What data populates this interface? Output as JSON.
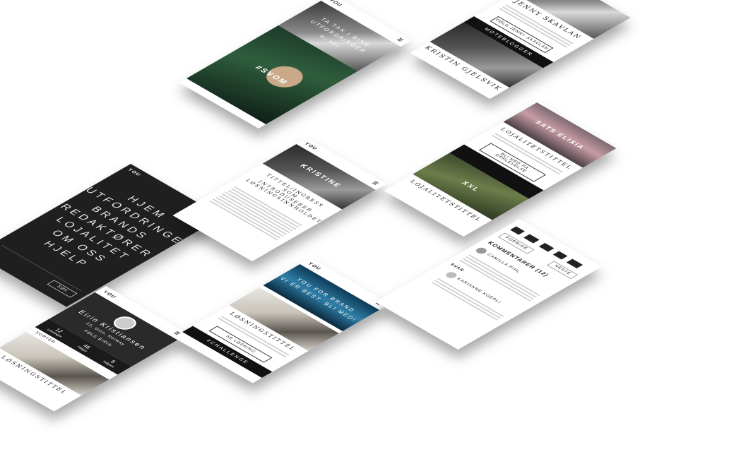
{
  "brand": "YOU",
  "screens": {
    "top_left": {
      "hero_lines": [
        "TA TAK I DINE",
        "UTFORDRINGER"
      ],
      "hero_sub": "BLI MED",
      "card_tag": "#SVOM",
      "card_caption": "#SVOM"
    },
    "top_right": {
      "name_1": "JENNY SKAVLAN",
      "button_1": "FØLG JENNY SKAVLAN",
      "bar_label": "MOTEBLOGGER",
      "name_2": "KRISTIN GJELSVIK"
    },
    "menu": {
      "close": "×",
      "items": [
        "HJEM",
        "UTFORDRINGER",
        "BRANDS",
        "REDAKTØRER",
        "LOJALITET",
        "OM OSS",
        "HJELP"
      ],
      "search_button": "SØK"
    },
    "article": {
      "hero_title": "KRISTINE",
      "title": "TITTEL/INGRESS SOM INTRODUSERER LØSNINGSINNHOLDET"
    },
    "loyalty": {
      "hero_title": "SATS ELIXIA",
      "title_1": "LOJALITETSTITTEL",
      "button_1": "BLI MED PÅ OPPLEVELSE",
      "hero_title_2": "XXL",
      "title_2": "LOJALITETSTITTEL"
    },
    "profile": {
      "name": "Eirin Kristiansen",
      "location": "22, Oslo, Norway",
      "follow": "FØLG EIRIN",
      "stats": [
        {
          "value": "12",
          "label": "Løsninger"
        },
        {
          "value": "46",
          "label": "Følger"
        },
        {
          "value": "5",
          "label": "Følgere"
        }
      ],
      "sort_label": "SORTER",
      "solution_title": "LØSNINGSTITTEL"
    },
    "challenge": {
      "hero_lines": [
        "YOU FOR BRAND",
        "VI ER BEST. BLI MED!"
      ],
      "solution_title": "LØSNINGSTITTEL",
      "button": "SE LØSNING",
      "challenge_tag": "#CHALLENGE"
    },
    "comments": {
      "prev": "FORRIGE",
      "next": "NESTE",
      "section_title": "KOMMENTARER (12)",
      "commenter_1": "CAMILLA PIHL",
      "reply_label": "SVAR",
      "commenter_2": "KARIANNE KOERLI"
    }
  }
}
